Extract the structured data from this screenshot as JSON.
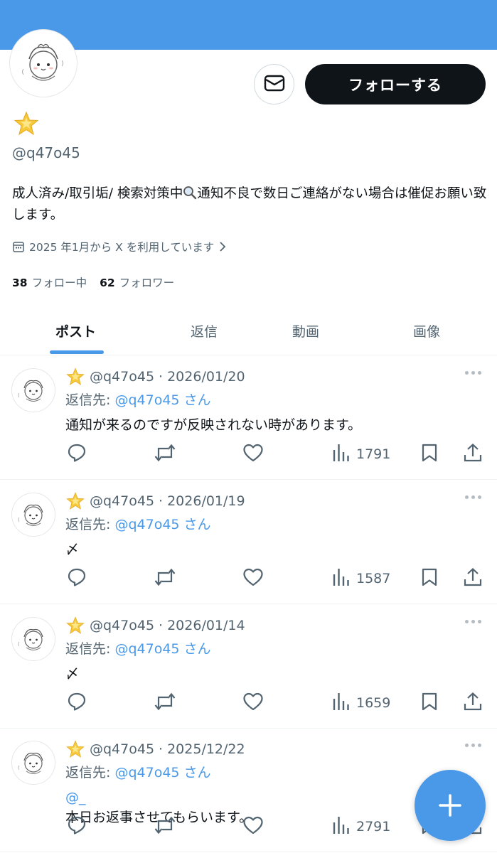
{
  "profile": {
    "handle": "@q47o45",
    "bio_part1": "成人済み/取引垢/ 検索対策中",
    "bio_part2": "通知不良で数日ご連絡がない場合は催促お願い致します。",
    "joined": "2025 年1月から X を利用しています",
    "following_count": "38",
    "following_label": "フォロー中",
    "followers_count": "62",
    "followers_label": "フォロワー",
    "follow_button": "フォローする"
  },
  "tabs": [
    {
      "label": "ポスト",
      "active": true
    },
    {
      "label": "返信",
      "active": false
    },
    {
      "label": "動画",
      "active": false
    },
    {
      "label": "画像",
      "active": false
    }
  ],
  "posts": [
    {
      "handle": "@q47o45",
      "date": "2026/01/20",
      "reply_prefix": "返信先:",
      "reply_to": "@q47o45 さん",
      "mention": "",
      "text": "通知が来るのですが反映されない時があります。",
      "views": "1791"
    },
    {
      "handle": "@q47o45",
      "date": "2026/01/19",
      "reply_prefix": "返信先:",
      "reply_to": "@q47o45 さん",
      "mention": "",
      "text": "〆",
      "views": "1587"
    },
    {
      "handle": "@q47o45",
      "date": "2026/01/14",
      "reply_prefix": "返信先:",
      "reply_to": "@q47o45 さん",
      "mention": "",
      "text": "〆",
      "views": "1659"
    },
    {
      "handle": "@q47o45",
      "date": "2025/12/22",
      "reply_prefix": "返信先:",
      "reply_to": "@q47o45 さん",
      "mention": "@_",
      "text": "本日お返事させてもらいます。",
      "views": "2791"
    }
  ],
  "icons": {
    "message": "envelope-icon",
    "star": "glowing-star-icon",
    "search": "magnifier-icon",
    "calendar": "calendar-icon",
    "reply": "reply-icon",
    "repost": "repost-icon",
    "like": "heart-icon",
    "views": "views-icon",
    "bookmark": "bookmark-icon",
    "share": "share-icon",
    "compose": "plus-icon"
  },
  "colors": {
    "accent": "#4a99e9",
    "text": "#0f1419",
    "muted": "#536471",
    "button_dark": "#0f1419"
  }
}
